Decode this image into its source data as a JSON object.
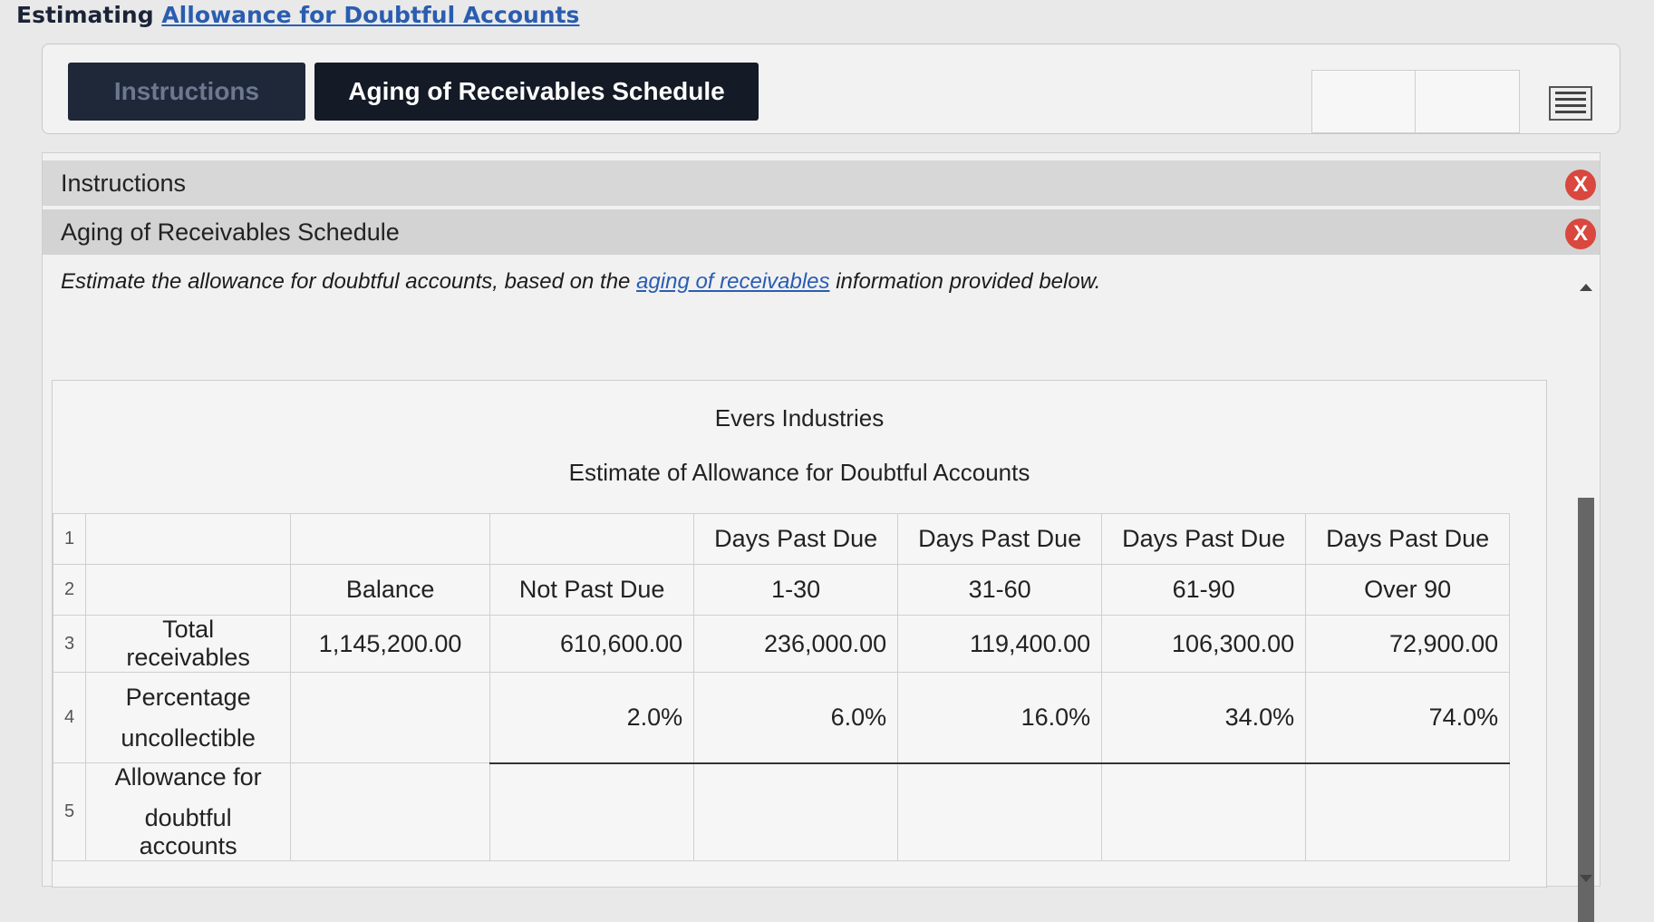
{
  "page": {
    "title_prefix": "Estimating ",
    "title_link": "Allowance for Doubtful Accounts"
  },
  "tabs": [
    {
      "label": "Instructions"
    },
    {
      "label": "Aging of Receivables Schedule"
    }
  ],
  "accordion": [
    {
      "label": "Instructions",
      "close": "X"
    },
    {
      "label": "Aging of Receivables Schedule",
      "close": "X"
    }
  ],
  "instruction": {
    "before": "Estimate the allowance for doubtful accounts, based on the ",
    "link": "aging of receivables",
    "after": " information provided below."
  },
  "sheet": {
    "company": "Evers Industries",
    "title": "Estimate of Allowance for Doubtful Accounts",
    "row_numbers": [
      "1",
      "2",
      "3",
      "4",
      "5"
    ],
    "header1": [
      "",
      "",
      "",
      "Days Past Due",
      "Days Past Due",
      "Days Past Due",
      "Days Past Due"
    ],
    "header2": [
      "",
      "Balance",
      "Not Past Due",
      "1-30",
      "31-60",
      "61-90",
      "Over 90"
    ],
    "total_receivables": {
      "label": "Total receivables",
      "values": [
        "1,145,200.00",
        "610,600.00",
        "236,000.00",
        "119,400.00",
        "106,300.00",
        "72,900.00"
      ]
    },
    "percentage": {
      "label_line1": "Percentage",
      "label_line2": "uncollectible",
      "values": [
        "",
        "2.0%",
        "6.0%",
        "16.0%",
        "34.0%",
        "74.0%"
      ]
    },
    "allowance": {
      "label_line1": "Allowance for",
      "label_line2": "doubtful accounts",
      "values": [
        "",
        "",
        "",
        "",
        "",
        ""
      ]
    }
  }
}
